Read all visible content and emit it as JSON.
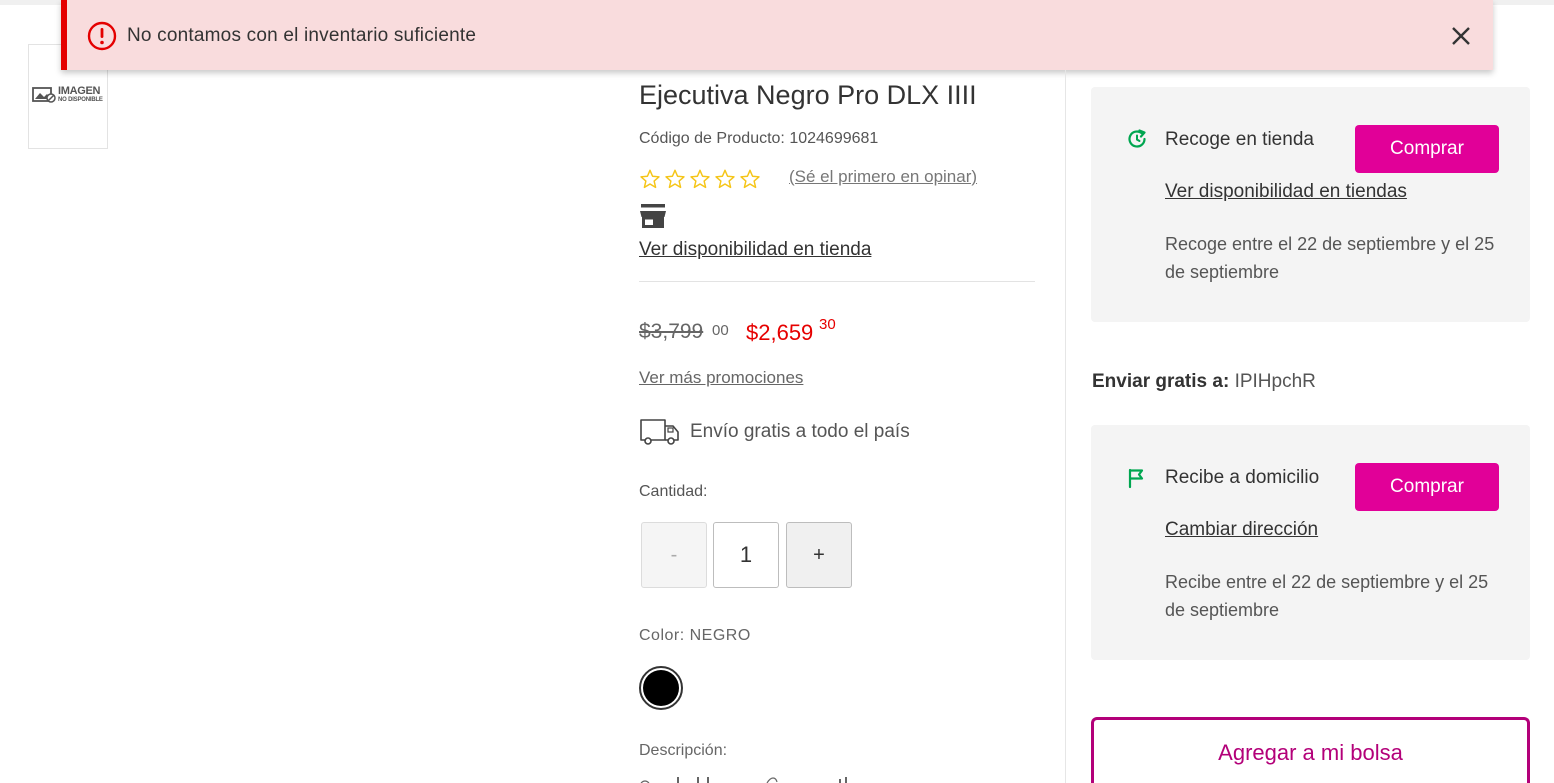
{
  "alert": {
    "message": "No contamos con el inventario suficiente"
  },
  "thumbnail": {
    "placeholder_big": "IMAGEN",
    "placeholder_small": "NO DISPONIBLE"
  },
  "product": {
    "title": "Ejecutiva Negro Pro DLX IIII",
    "code_label": "Código de Producto: 1024699681",
    "rating_stars": 0,
    "rating_max": 5,
    "review_link": "(Sé el primero en opinar)",
    "store_availability_link": "Ver disponibilidad en tienda",
    "old_price": "$3,799",
    "old_price_cents": "00",
    "new_price": "$2,659",
    "new_price_cents": "30",
    "promo_link": "Ver más promociones",
    "shipping_text": "Envío gratis a todo el país",
    "quantity_label": "Cantidad:",
    "quantity_minus": "-",
    "quantity_value": "1",
    "quantity_plus": "+",
    "color_label": "Color: NEGRO",
    "color_swatch": "#000000",
    "description_label": "Descripción:"
  },
  "pickup": {
    "title": "Recoge en tienda",
    "button": "Comprar",
    "link": "Ver disponibilidad en tiendas",
    "text": "Recoge entre el 22 de septiembre y el 25 de septiembre"
  },
  "ship_to": {
    "label": "Enviar gratis a:",
    "value": "IPIHpchR"
  },
  "home_delivery": {
    "title": "Recibe a domicilio",
    "button": "Comprar",
    "link": "Cambiar dirección",
    "text": "Recibe entre el 22 de septiembre y el 25 de septiembre"
  },
  "add_to_bag": "Agregar a mi bolsa",
  "colors": {
    "alert_bg": "#f9dcdd",
    "alert_accent": "#e40000",
    "brand_pink": "#e10098",
    "bag_border": "#b30079",
    "sale_price": "#e60000",
    "icon_green": "#00a650",
    "star_yellow": "#f5c518"
  }
}
